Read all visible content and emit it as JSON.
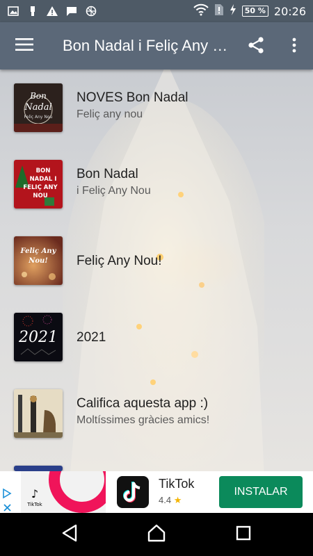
{
  "status_bar": {
    "battery": "50 %",
    "time": "20:26"
  },
  "app_bar": {
    "title": "Bon Nadal i Feliç Any Nou"
  },
  "items": [
    {
      "title": "NOVES Bon Nadal",
      "subtitle": "Feliç any nou",
      "thumb_text": [
        "Bon",
        "Nadal",
        "Feliç Any Nou"
      ]
    },
    {
      "title": "Bon Nadal",
      "subtitle": "i Feliç Any Nou",
      "thumb_text": [
        "BON",
        "NADAL I",
        "FELIÇ ANY",
        "NOU"
      ]
    },
    {
      "title": "Feliç Any Nou!",
      "subtitle": "",
      "thumb_text": [
        "Feliç Any",
        "Nou!"
      ]
    },
    {
      "title": "2021",
      "subtitle": "",
      "thumb_text": [
        "2021"
      ]
    },
    {
      "title": "Califica aquesta app :)",
      "subtitle": "Moltíssimes gràcies amics!",
      "thumb_text": []
    }
  ],
  "ad": {
    "app_name": "TikTok",
    "rating": "4.4",
    "install_label": "INSTALAR",
    "thumb_label": "TikTok"
  },
  "colors": {
    "status_bar": "#4e5a66",
    "app_bar": "#5b6878",
    "install_button": "#0b8a5b"
  },
  "icons": {
    "menu": "hamburger-icon",
    "share": "share-icon",
    "more": "more-vert-icon",
    "back": "back-triangle-icon",
    "home": "home-icon",
    "recents": "recents-square-icon"
  }
}
